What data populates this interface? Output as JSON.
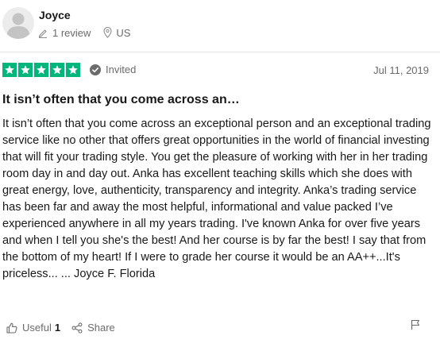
{
  "reviewer": {
    "name": "Joyce",
    "review_count": "1 review",
    "location": "US",
    "avatar_icon": "person-silhouette-icon"
  },
  "review": {
    "rating": 5,
    "rating_max": 5,
    "star_color": "#00b67a",
    "verification": "Invited",
    "date": "Jul 11, 2019",
    "title": "It isn’t often that you come across an…",
    "body": "It isn’t often that you come across an exceptional person and an exceptional trading service like no other that offers great opportunities in the world of financial investing that will fit your trading style. You get the pleasure of working with her in her trading room day in and day out. Anka has excellent teaching skills which she does with great energy, love, authenticity, transparency and integrity. Anka’s trading service has been far and away the most helpful, informational and value packed I’ve experienced anywhere in all my years trading. I've known Anka for over five years and when I tell you she's the best! And her course is by far the best! I say that from the bottom of my heart! If I were to grade her course it would be an AA++...It's priceless... ... Joyce F. Florida"
  },
  "actions": {
    "useful_label": "Useful",
    "useful_count": "1",
    "share_label": "Share"
  },
  "icons": {
    "pencil": "pencil-icon",
    "location": "location-pin-icon",
    "verified": "check-circle-icon",
    "thumbs_up": "thumbs-up-icon",
    "share": "share-icon",
    "flag": "flag-icon"
  }
}
